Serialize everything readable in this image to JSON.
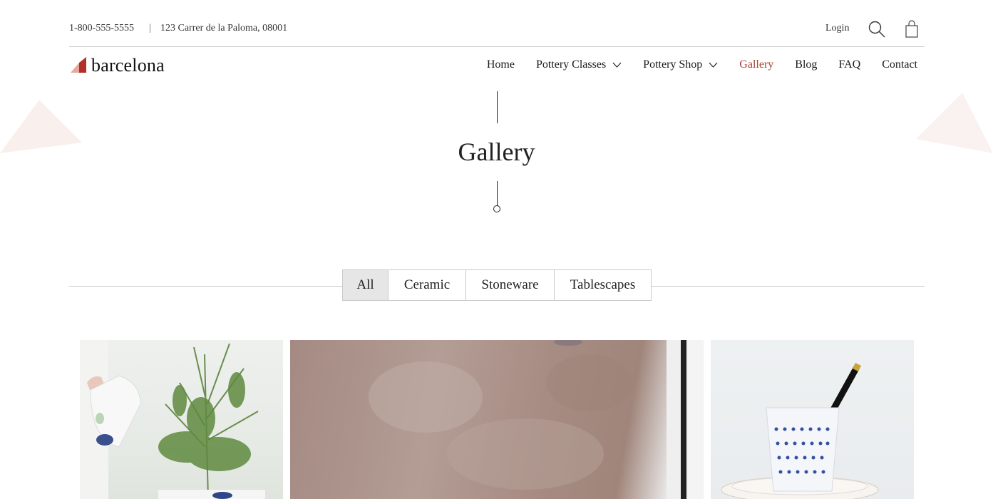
{
  "topbar": {
    "phone": "1-800-555-5555",
    "separator": "|",
    "address": "123 Carrer de la Paloma, 08001",
    "login": "Login",
    "search_icon": "search-icon",
    "cart_icon": "shopping-bag-icon"
  },
  "logo": {
    "text": "barcelona",
    "colors": {
      "dark": "#b2302a",
      "light": "#e6a79d"
    }
  },
  "nav": {
    "items": [
      {
        "label": "Home",
        "dropdown": false
      },
      {
        "label": "Pottery Classes",
        "dropdown": true
      },
      {
        "label": "Pottery Shop",
        "dropdown": true
      },
      {
        "label": "Gallery",
        "dropdown": false,
        "active": true
      },
      {
        "label": "Blog",
        "dropdown": false
      },
      {
        "label": "FAQ",
        "dropdown": false
      },
      {
        "label": "Contact",
        "dropdown": false
      }
    ],
    "active_color": "#a8402f"
  },
  "hero": {
    "title": "Gallery"
  },
  "filters": {
    "tabs": [
      {
        "label": "All",
        "active": true
      },
      {
        "label": "Ceramic",
        "active": false
      },
      {
        "label": "Stoneware",
        "active": false
      },
      {
        "label": "Tablescapes",
        "active": false
      }
    ]
  },
  "gallery": {
    "items": [
      {
        "subject": "watering-rosemary-planter"
      },
      {
        "subject": "mauve-textured-wall-with-frame"
      },
      {
        "subject": "patterned-cup-with-pencil"
      }
    ]
  }
}
